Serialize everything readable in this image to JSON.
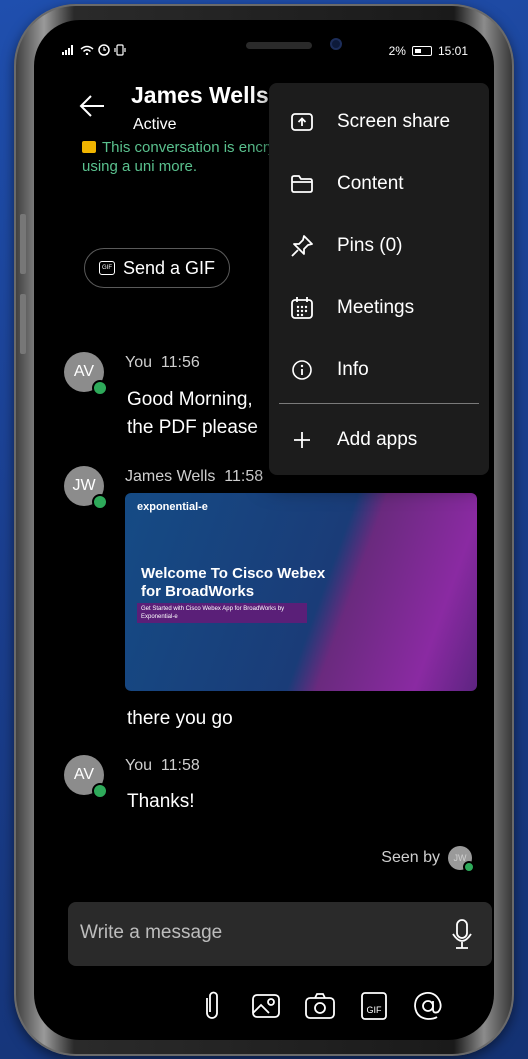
{
  "statusbar": {
    "signal": "📶",
    "battery_percent": "2%",
    "time": "15:01"
  },
  "header": {
    "contact_name": "James Wells",
    "contact_status": "Active"
  },
  "encryption_notice": {
    "text": "This conversation is encryption using a uni more."
  },
  "gif_chip": {
    "label": "Send a GIF",
    "icon_text": "GIF"
  },
  "messages": [
    {
      "avatar": "AV",
      "sender": "You",
      "time": "11:56",
      "lines": [
        "Good Morning,",
        "the PDF please"
      ]
    },
    {
      "avatar": "JW",
      "sender": "James Wells",
      "time": "11:58",
      "attachment": {
        "logo": "exponential-e",
        "title": "Welcome To Cisco Webex for BroadWorks",
        "subtitle": "Get Started with Cisco Webex App for BroadWorks by Exponential-e"
      },
      "lines": [
        "there you go"
      ]
    },
    {
      "avatar": "AV",
      "sender": "You",
      "time": "11:58",
      "lines": [
        "Thanks!"
      ]
    }
  ],
  "seen": {
    "label": "Seen by",
    "avatar": "JW"
  },
  "composer": {
    "placeholder": "Write a message"
  },
  "toolbar": {
    "gif_label": "GIF"
  },
  "menu": {
    "items": [
      {
        "label": "Screen share",
        "icon": "screen-share-icon"
      },
      {
        "label": "Content",
        "icon": "folder-icon"
      },
      {
        "label": "Pins (0)",
        "icon": "pin-icon"
      },
      {
        "label": "Meetings",
        "icon": "calendar-icon"
      },
      {
        "label": "Info",
        "icon": "info-icon"
      },
      {
        "label": "Add apps",
        "icon": "plus-icon"
      }
    ]
  },
  "colors": {
    "accent_green": "#2eaa5a",
    "encryption_text": "#5ac18e",
    "menu_bg": "#1c1c1c"
  }
}
